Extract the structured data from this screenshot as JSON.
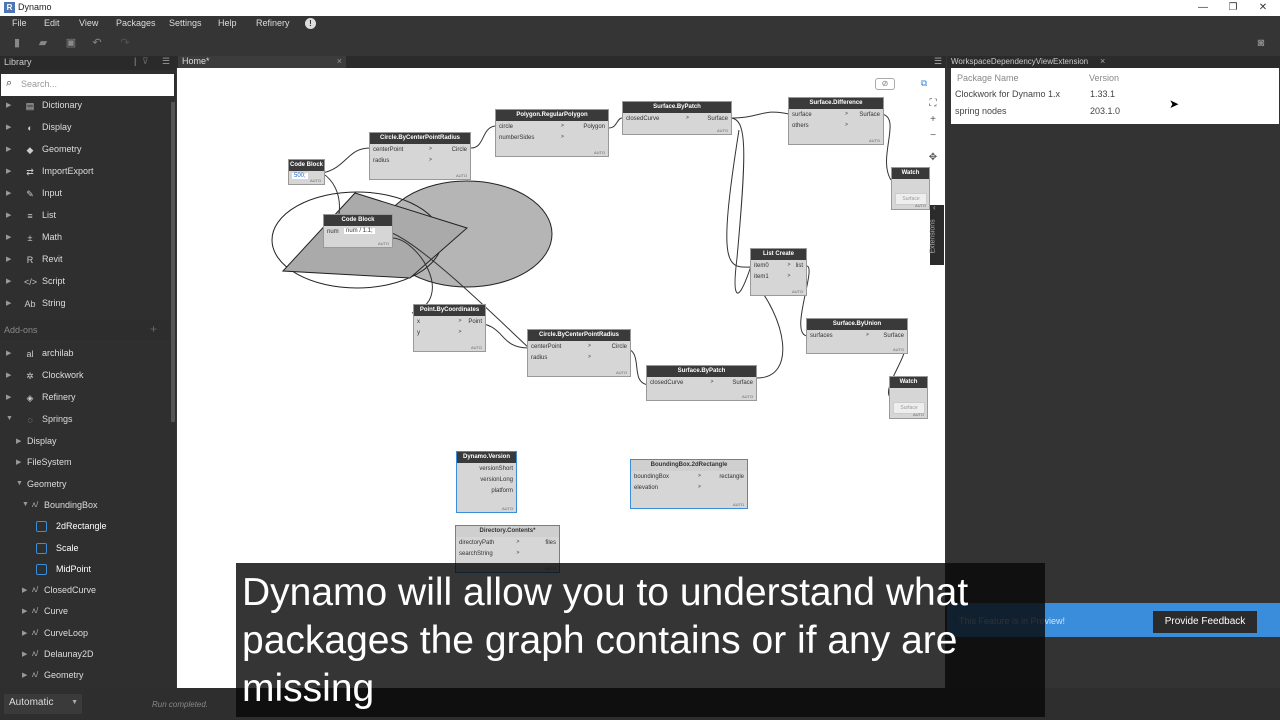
{
  "window": {
    "title": "Dynamo",
    "logo": "R"
  },
  "menu": [
    "File",
    "Edit",
    "View",
    "Packages",
    "Settings",
    "Help",
    "Refinery"
  ],
  "library": {
    "header": "Library",
    "search_placeholder": "Search...",
    "items": [
      {
        "label": "Dictionary",
        "icon": "dictionary-icon",
        "glyph": "▤"
      },
      {
        "label": "Display",
        "icon": "display-icon",
        "glyph": "◐"
      },
      {
        "label": "Geometry",
        "icon": "geometry-icon",
        "glyph": "◆"
      },
      {
        "label": "ImportExport",
        "icon": "importexport-icon",
        "glyph": "⇄"
      },
      {
        "label": "Input",
        "icon": "input-icon",
        "glyph": "✎"
      },
      {
        "label": "List",
        "icon": "list-icon",
        "glyph": "≡"
      },
      {
        "label": "Math",
        "icon": "math-icon",
        "glyph": "±"
      },
      {
        "label": "Revit",
        "icon": "revit-icon",
        "glyph": "R"
      },
      {
        "label": "Script",
        "icon": "script-icon",
        "glyph": "</>"
      },
      {
        "label": "String",
        "icon": "string-icon",
        "glyph": "Ab"
      }
    ],
    "addons_label": "Add-ons",
    "addons": [
      {
        "label": "archilab",
        "icon": "archilab-icon",
        "glyph": "al"
      },
      {
        "label": "Clockwork",
        "icon": "clockwork-icon",
        "glyph": "✲"
      },
      {
        "label": "Refinery",
        "icon": "refinery-icon",
        "glyph": "◈"
      },
      {
        "label": "Springs",
        "icon": "springs-icon",
        "glyph": "◌"
      }
    ],
    "springs_children": [
      "Display",
      "FileSystem",
      "Geometry"
    ],
    "geometry_children": [
      "BoundingBox"
    ],
    "boundingbox_children": [
      "2dRectangle",
      "Scale",
      "MidPoint"
    ],
    "more_geometry": [
      "ClosedCurve",
      "Curve",
      "CurveLoop",
      "Delaunay2D",
      "Geometry"
    ]
  },
  "canvas": {
    "tab": "Home*",
    "nodes": {
      "code_block_1": {
        "title": "Code Block",
        "code": "500;"
      },
      "code_block_2": {
        "title": "Code Block",
        "code": "num",
        "code2": "num / 1.1;"
      },
      "circle1": {
        "title": "Circle.ByCenterPointRadius",
        "in1": "centerPoint",
        "in2": "radius",
        "out": "Circle"
      },
      "polygon": {
        "title": "Polygon.RegularPolygon",
        "in1": "circle",
        "in2": "numberSides",
        "out": "Polygon"
      },
      "surface1": {
        "title": "Surface.ByPatch",
        "in1": "closedCurve",
        "out": "Surface"
      },
      "difference": {
        "title": "Surface.Difference",
        "in1": "surface",
        "in2": "others",
        "out": "Surface"
      },
      "watch1": {
        "title": "Watch",
        "val": "Surface"
      },
      "list_create": {
        "title": "List Create",
        "in1": "item0",
        "in2": "item1",
        "out": "list"
      },
      "union": {
        "title": "Surface.ByUnion",
        "in1": "surfaces",
        "out": "Surface"
      },
      "watch2": {
        "title": "Watch",
        "val": "Surface"
      },
      "pointcoords": {
        "title": "Point.ByCoordinates",
        "in1": "x",
        "in2": "y",
        "out": "Point"
      },
      "circle2": {
        "title": "Circle.ByCenterPointRadius",
        "in1": "centerPoint",
        "in2": "radius",
        "out": "Circle"
      },
      "surface2": {
        "title": "Surface.ByPatch",
        "in1": "closedCurve",
        "out": "Surface"
      },
      "version": {
        "title": "Dynamo.Version",
        "o1": "versionShort",
        "o2": "versionLong",
        "o3": "platform"
      },
      "bbox": {
        "title": "BoundingBox.2dRectangle",
        "in1": "boundingBox",
        "in2": "elevation",
        "out": "rectangle"
      },
      "directory": {
        "title": "Directory.Contents*",
        "in1": "directoryPath",
        "in2": "searchString",
        "out": "files"
      }
    },
    "auto": "AUTO"
  },
  "extension": {
    "tab": "WorkspaceDependencyViewExtension",
    "columns": [
      "Package Name",
      "Version"
    ],
    "rows": [
      {
        "name": "Clockwork for Dynamo 1.x",
        "version": "1.33.1"
      },
      {
        "name": "spring nodes",
        "version": "203.1.0"
      }
    ],
    "side_label": "Extensions",
    "banner_text": "This Feature is in Preview!",
    "feedback_button": "Provide Feedback"
  },
  "status": {
    "run_mode": "Automatic",
    "message": "Run completed."
  },
  "caption": "Dynamo will allow you to understand what packages the graph contains or if any are missing"
}
